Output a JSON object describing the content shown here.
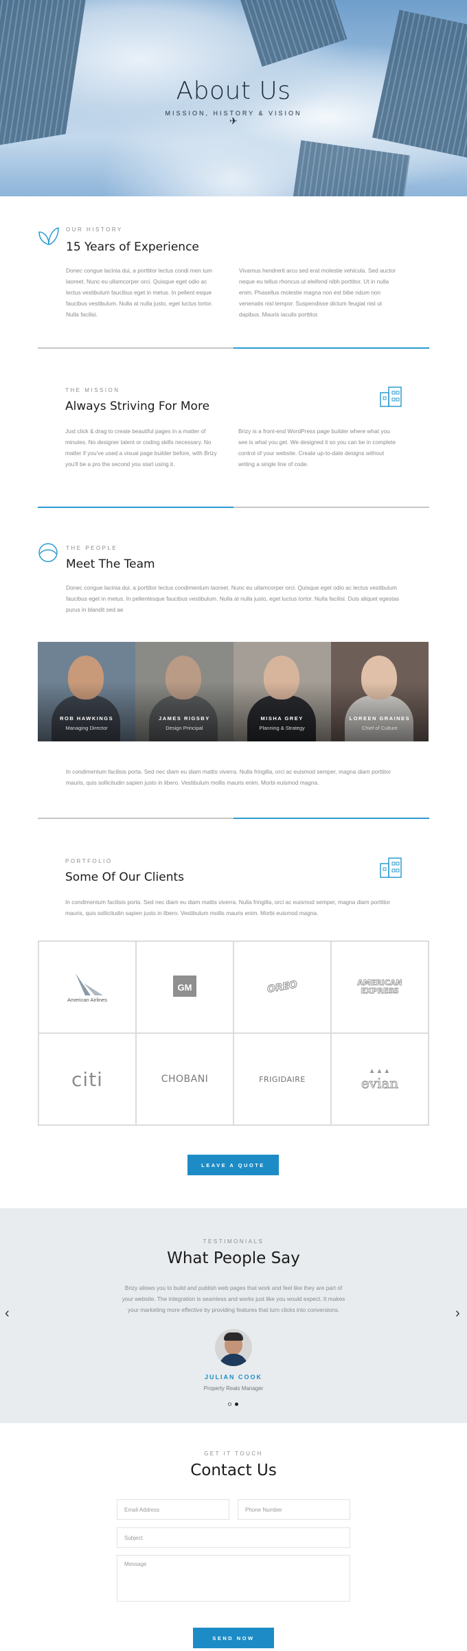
{
  "hero": {
    "title": "About Us",
    "subtitle": "MISSION, HISTORY & VISION"
  },
  "history": {
    "eyebrow": "OUR HISTORY",
    "heading": "15 Years of Experience",
    "col1": "Donec congue lacinia dui, a porttitor lectus condi men tum laoreet. Nunc eu ullamcorper orci. Quisque eget odio ac lectus vestibulum faucibus eget in metus. In pellent esque faucibus vestibulum. Nulla at nulla justo, eget luctus tortor. Nulla facilisi.",
    "col2": "Vivamus hendrerit arcu sed erat molestie vehicula. Sed auctor neque eu tellus rhoncus ut eleifend nibh porttitor. Ut in nulla enim. Phasellus molestie magna non est bibe ndum non venenatis nisl tempor. Suspendisse dictum feugiat nisl ut dapibus. Mauris iaculis porttitor."
  },
  "mission": {
    "eyebrow": "THE MISSION",
    "heading": "Always Striving For More",
    "col1": "Just click & drag to create beautiful pages in a matter of minutes. No designer talent or coding skills necessary. No matter if you've used a visual page builder before, with Brizy you'll be a pro the second you start using it.",
    "col2": "Brizy is a front-end WordPress page builder where what you see is what you get. We designed it so you can be in complete control of your website. Create up-to-date designs without writing a single line of code."
  },
  "people": {
    "eyebrow": "THE PEOPLE",
    "heading": "Meet The Team",
    "intro": "Donec congue lacinia dui, a porttitor lectus condimentum laoreet. Nunc eu ullamcorper orci. Quisque eget odio ac lectus vestibulum faucibus eget in metus. In pellentesque faucibus vestibulum. Nulla at nulla justo, eget luctus tortor. Nulla facilisi. Duis aliquet egestas purus in blandit sed ae",
    "members": [
      {
        "name": "ROB HAWKINGS",
        "role": "Managing Director"
      },
      {
        "name": "JAMES RIGSBY",
        "role": "Design Principal"
      },
      {
        "name": "MISHA GREY",
        "role": "Planning & Strategy"
      },
      {
        "name": "LOREEN GRAINES",
        "role": "Chief of Culture"
      }
    ],
    "outro": "In condimentum facilisis porta. Sed nec diam eu diam mattis viverra. Nulla fringilla, orci ac euismod semper, magna diam porttitor mauris, quis sollicitudin sapien justo in libero. Vestibulum mollis mauris enim. Morbi euismod magna."
  },
  "portfolio": {
    "eyebrow": "PORTFOLIO",
    "heading": "Some Of Our Clients",
    "intro": "In condimentum facilisis porta. Sed nec diam eu diam mattis viverra. Nulla fringilla, orci ac euismod semper, magna diam porttitor mauris, quis sollicitudin sapien justo in libero. Vestibulum mollis mauris enim. Morbi euismod magna.",
    "clients": [
      "American Airlines",
      "GM",
      "OREO",
      "AMERICAN EXPRESS",
      "citi",
      "CHOBANI",
      "FRIGIDAIRE",
      "evian"
    ],
    "cta": "LEAVE A QUOTE"
  },
  "testimonials": {
    "eyebrow": "TESTIMONIALS",
    "heading": "What People Say",
    "quote": "Brizy allows you to build and publish web pages that work and feel like they are part of your website. The integration is seamless and works just like you would expect. It makes your marketing more effective by providing features that turn clicks into conversions.",
    "name": "JULIAN COOK",
    "role": "Property Reals Manager",
    "prev_icon": "chevron-left-icon",
    "next_icon": "chevron-right-icon"
  },
  "contact": {
    "eyebrow": "GET IT TOUCH",
    "heading": "Contact Us",
    "email_placeholder": "Email Address",
    "phone_placeholder": "Phone Number",
    "subject_placeholder": "Subject",
    "message_placeholder": "Message",
    "submit": "SEND NOW"
  },
  "colors": {
    "accent": "#1d8cc6",
    "rule_blue": "#2b9bd1",
    "testimonial_bg": "#e8ecef"
  }
}
